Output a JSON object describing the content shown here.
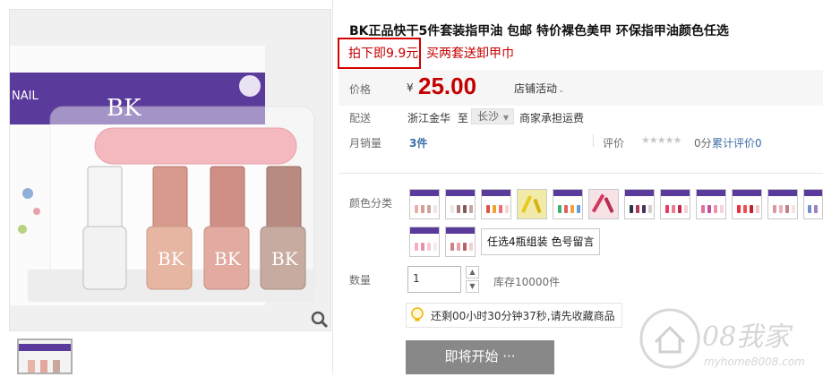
{
  "product": {
    "title": "BK正品快干5件套装指甲油 包邮 特价裸色美甲 环保指甲油颜色任选",
    "promo_main": "拍下即9.9元",
    "promo_extra": "买两套送卸甲巾",
    "image_brand": "BK",
    "image_box_text": "NAIL"
  },
  "price": {
    "label": "价格",
    "currency": "¥",
    "value": "25.00",
    "shop_activity": "店铺活动"
  },
  "delivery": {
    "label": "配送",
    "from": "浙江金华",
    "to_word": "至",
    "city": "长沙",
    "fee": "商家承担运费"
  },
  "sales": {
    "label": "月销量",
    "value": "3件"
  },
  "rating": {
    "label": "评价",
    "stars": "★★★★★",
    "score": "0分",
    "reviews": "累计评价0"
  },
  "color_category": {
    "label": "颜色分类",
    "selected_text": "任选4瓶组装 色号留言"
  },
  "quantity": {
    "label": "数量",
    "value": "1",
    "stock": "库存10000件"
  },
  "notice": {
    "text": "还剩00小时30分钟37秒,请先收藏商品"
  },
  "buy_button": {
    "label": "即将开始 ···"
  },
  "watermark": {
    "brand": "08我家",
    "url": "myhome8008.com"
  },
  "colors": {
    "accent": "#c40000",
    "link": "#3c6ea8",
    "button": "#888888"
  }
}
